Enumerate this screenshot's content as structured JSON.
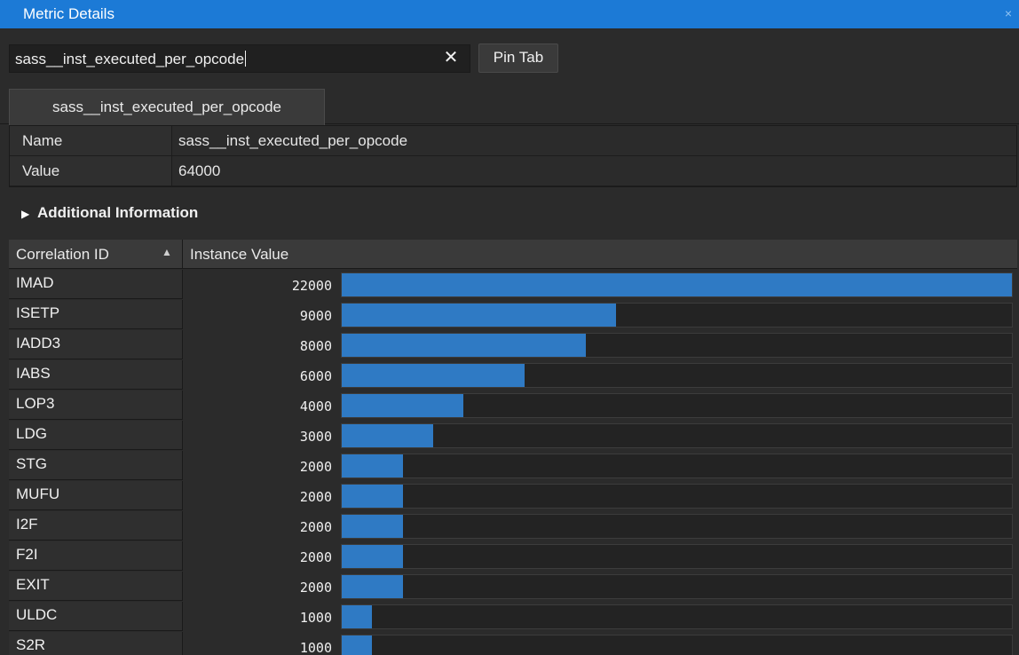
{
  "window": {
    "title": "Metric Details",
    "close_icon": "×"
  },
  "search": {
    "value": "sass__inst_executed_per_opcode",
    "clear_icon": "✕",
    "pin_label": "Pin Tab"
  },
  "tab": {
    "label": "sass__inst_executed_per_opcode"
  },
  "properties": [
    {
      "key": "Name",
      "value": "sass__inst_executed_per_opcode"
    },
    {
      "key": "Value",
      "value": "64000"
    }
  ],
  "additional_info": {
    "label": "Additional Information",
    "expanded": false
  },
  "table": {
    "headers": {
      "correlation_id": "Correlation ID",
      "instance_value": "Instance Value"
    },
    "sort_direction": "ascending",
    "max_value": 22000,
    "bar_color": "#2f7ac4",
    "rows": [
      {
        "id": "IMAD",
        "value": "22000"
      },
      {
        "id": "ISETP",
        "value": "9000"
      },
      {
        "id": "IADD3",
        "value": "8000"
      },
      {
        "id": "IABS",
        "value": "6000"
      },
      {
        "id": "LOP3",
        "value": "4000"
      },
      {
        "id": "LDG",
        "value": "3000"
      },
      {
        "id": "STG",
        "value": "2000"
      },
      {
        "id": "MUFU",
        "value": "2000"
      },
      {
        "id": "I2F",
        "value": "2000"
      },
      {
        "id": "F2I",
        "value": "2000"
      },
      {
        "id": "EXIT",
        "value": "2000"
      },
      {
        "id": "ULDC",
        "value": "1000"
      },
      {
        "id": "S2R",
        "value": "1000"
      }
    ]
  },
  "colors": {
    "titlebar": "#1c7ad6",
    "background": "#2b2b2b",
    "accent_bar": "#2f7ac4"
  }
}
